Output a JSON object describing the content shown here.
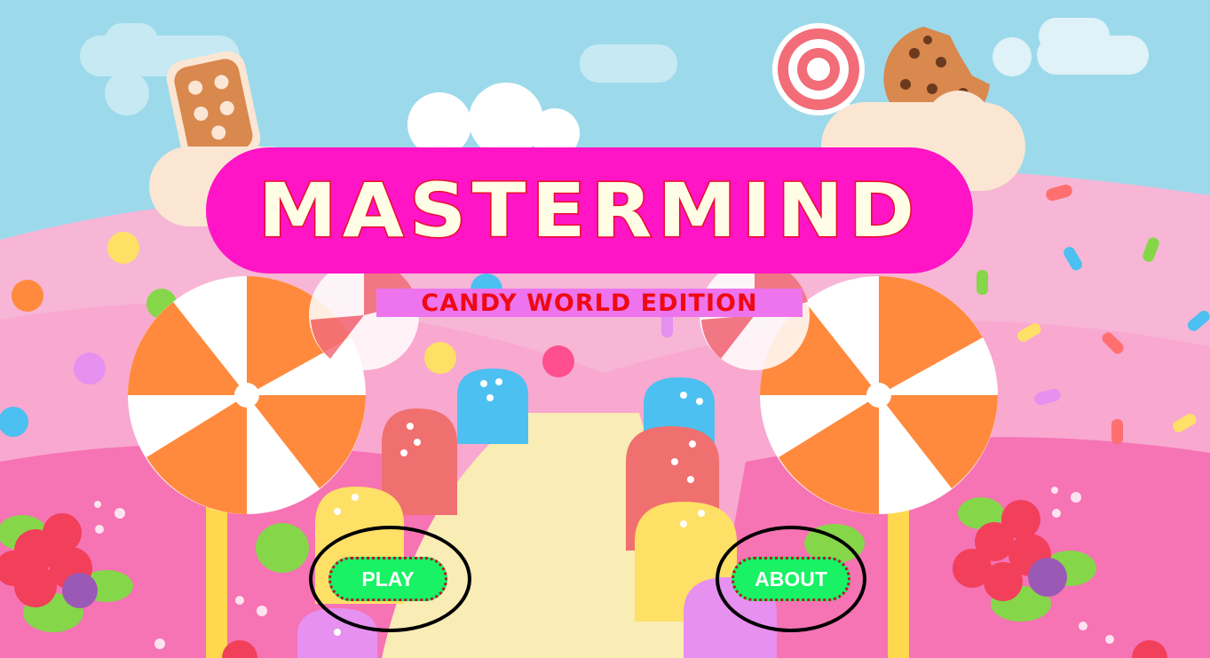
{
  "title": "MASTERMIND",
  "subtitle": "CANDY WORLD EDITION",
  "buttons": {
    "play": "PLAY",
    "about": "ABOUT"
  },
  "colors": {
    "sky": "#9cdaeb",
    "title_banner": "#ff14c6",
    "title_text": "#fffde6",
    "title_outline": "#e8102a",
    "subtitle_bg": "#ee74ee",
    "subtitle_text": "#ee0a14",
    "button_bg": "#18f264",
    "button_border": "#b5172a"
  },
  "background": {
    "scene": "candy-land",
    "icons": [
      "cloud-icon",
      "ice-cream-bar-icon",
      "lollipop-icon",
      "cookie-icon",
      "swirl-lollipop-icon",
      "gumdrop-icon",
      "candy-path",
      "berry-bush-icon",
      "sprinkle-icon"
    ]
  }
}
